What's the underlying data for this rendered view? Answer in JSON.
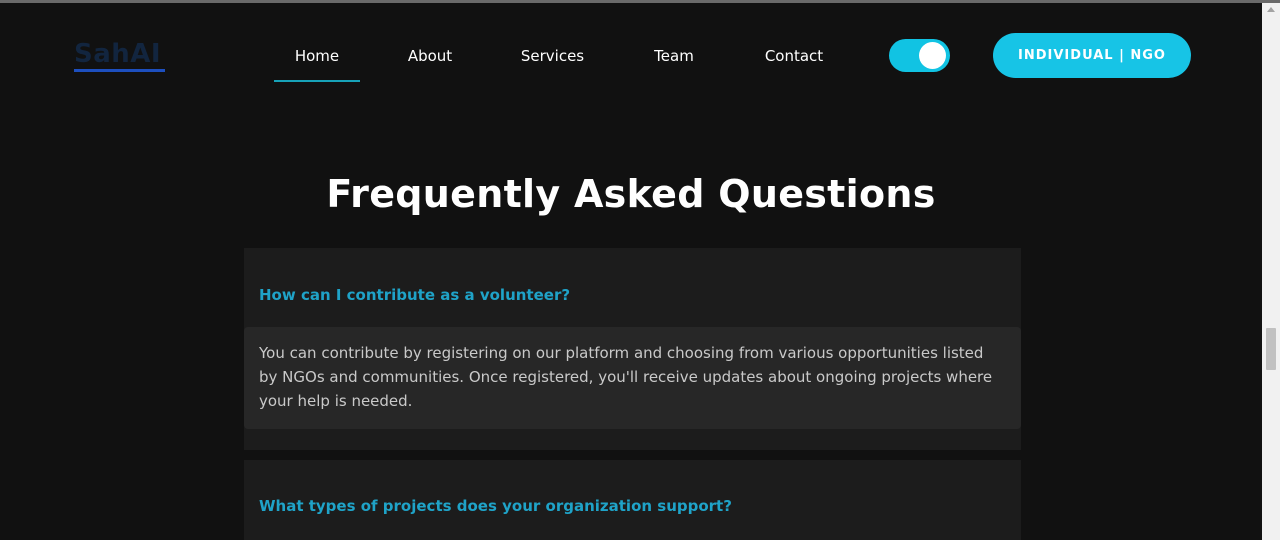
{
  "brand": {
    "logo_text": "SahAI",
    "accent": "#17c4e6",
    "active_underline": "#17a2b8"
  },
  "nav": {
    "items": [
      {
        "label": "Home",
        "active": true
      },
      {
        "label": "About",
        "active": false
      },
      {
        "label": "Services",
        "active": false
      },
      {
        "label": "Team",
        "active": false
      },
      {
        "label": "Contact",
        "active": false
      }
    ],
    "theme_toggle": {
      "on": true,
      "icon": "toggle-switch"
    },
    "cta_label": "INDIVIDUAL | NGO"
  },
  "faq": {
    "title": "Frequently Asked Questions",
    "items": [
      {
        "question": "How can I contribute as a volunteer?",
        "answer": "You can contribute by registering on our platform and choosing from various opportunities listed by NGOs and communities. Once registered, you'll receive updates about ongoing projects where your help is needed.",
        "expanded": true
      },
      {
        "question": "What types of projects does your organization support?",
        "expanded": false
      }
    ]
  },
  "colors": {
    "background": "#111111",
    "card": "#1c1c1c",
    "answer_bg": "#272727",
    "question": "#1fa3c8"
  }
}
